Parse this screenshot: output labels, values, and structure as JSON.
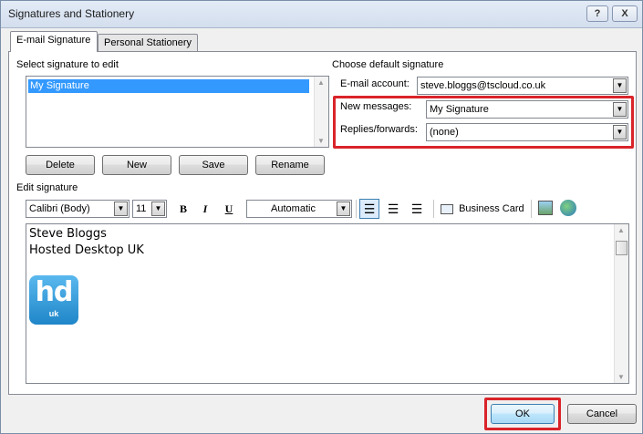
{
  "window": {
    "title": "Signatures and Stationery",
    "help_label": "?",
    "close_label": "X"
  },
  "tabs": [
    {
      "label": "E-mail Signature",
      "active": true
    },
    {
      "label": "Personal Stationery",
      "active": false
    }
  ],
  "select_section": {
    "label": "Select signature to edit",
    "items": [
      "My Signature"
    ],
    "selected": "My Signature"
  },
  "buttons": {
    "delete": "Delete",
    "new": "New",
    "save": "Save",
    "rename": "Rename",
    "ok": "OK",
    "cancel": "Cancel"
  },
  "default_section": {
    "label": "Choose default signature",
    "email_account_label": "E-mail account:",
    "email_account_value": "steve.bloggs@tscloud.co.uk",
    "new_messages_label": "New messages:",
    "new_messages_value": "My Signature",
    "replies_label": "Replies/forwards:",
    "replies_value": "(none)"
  },
  "edit_section": {
    "label": "Edit signature",
    "font": "Calibri (Body)",
    "size": "11",
    "bold": "B",
    "italic": "I",
    "underline": "U",
    "color": "Automatic",
    "business_card": "Business Card"
  },
  "editor": {
    "lines": [
      "Steve Bloggs",
      "Hosted Desktop UK"
    ],
    "logo_text": "hd",
    "logo_subtext": "uk"
  },
  "colors": {
    "highlight": "#d9242a",
    "selection": "#3399ff",
    "logo": "#2a94d6"
  }
}
